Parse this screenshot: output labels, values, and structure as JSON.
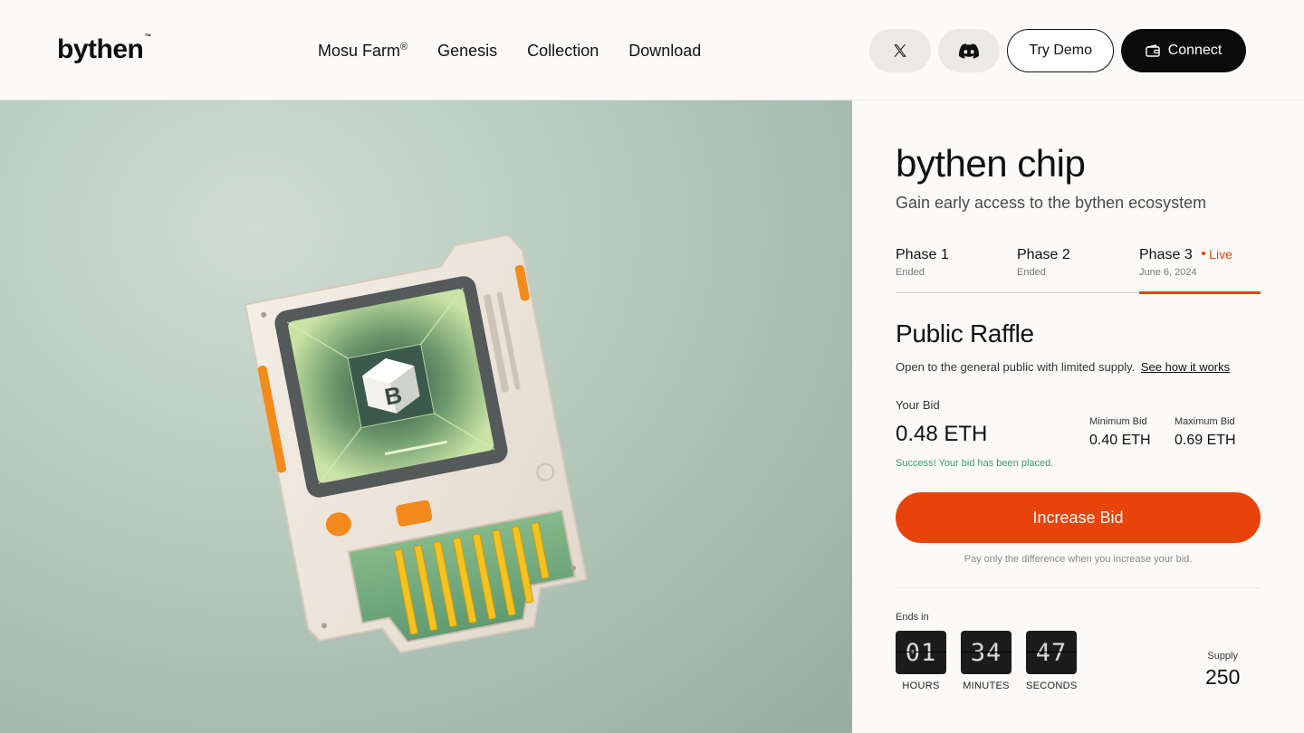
{
  "header": {
    "logo": "bythen",
    "logo_tm": "™",
    "nav": [
      {
        "label": "Mosu Farm",
        "sup": "®"
      },
      {
        "label": "Genesis"
      },
      {
        "label": "Collection"
      },
      {
        "label": "Download"
      }
    ],
    "try_demo": "Try Demo",
    "connect": "Connect",
    "icons": [
      "x-logo-icon",
      "discord-icon",
      "wallet-icon"
    ]
  },
  "product": {
    "title": "bythen chip",
    "subtitle": "Gain early access to the bythen ecosystem",
    "phases": [
      {
        "name": "Phase 1",
        "status": "Ended"
      },
      {
        "name": "Phase 2",
        "status": "Ended"
      },
      {
        "name": "Phase 3",
        "status": "June 6, 2024",
        "live": "Live",
        "active": true
      }
    ]
  },
  "raffle": {
    "title": "Public Raffle",
    "description": "Open to the general public with limited supply.",
    "how_link": "See how it works",
    "your_bid_label": "Your Bid",
    "your_bid": "0.48 ETH",
    "min_label": "Minimum Bid",
    "min_value": "0.40 ETH",
    "max_label": "Maximum Bid",
    "max_value": "0.69 ETH",
    "success": "Success! Your bid has been placed.",
    "increase_button": "Increase Bid",
    "note": "Pay only the difference when you increase your bid."
  },
  "countdown": {
    "ends_label": "Ends in",
    "hours": "01",
    "hours_label": "HOURS",
    "minutes": "34",
    "minutes_label": "MINUTES",
    "seconds": "47",
    "seconds_label": "SECONDS"
  },
  "supply": {
    "label": "Supply",
    "value": "250"
  },
  "colors": {
    "accent": "#e8430a",
    "success": "#3f9a5e",
    "dark": "#0b0b0b",
    "hero_bg": "#b5c9bc"
  }
}
